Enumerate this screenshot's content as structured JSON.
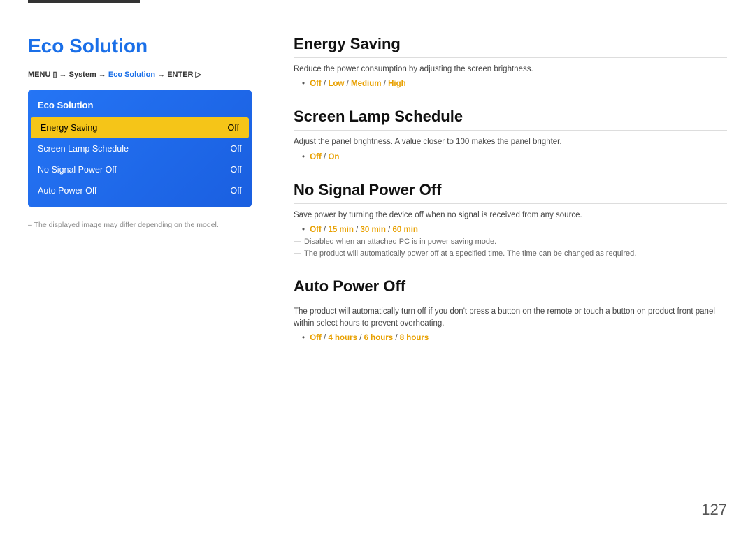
{
  "top": {
    "lines": true
  },
  "left": {
    "title": "Eco Solution",
    "menu_path": "MENU ⧧ → System → Eco Solution → ENTER ⧨",
    "menu_box_title": "Eco Solution",
    "menu_items": [
      {
        "label": "Energy Saving",
        "value": "Off",
        "active": true
      },
      {
        "label": "Screen Lamp Schedule",
        "value": "Off",
        "active": false
      },
      {
        "label": "No Signal Power Off",
        "value": "Off",
        "active": false
      },
      {
        "label": "Auto Power Off",
        "value": "Off",
        "active": false
      }
    ],
    "bottom_note": "– The displayed image may differ depending on the model."
  },
  "right": {
    "sections": [
      {
        "id": "energy-saving",
        "title": "Energy Saving",
        "desc": "Reduce the power consumption by adjusting the screen brightness.",
        "options_prefix": "•",
        "options": "Off / Low / Medium / High",
        "notes": []
      },
      {
        "id": "screen-lamp-schedule",
        "title": "Screen Lamp Schedule",
        "desc": "Adjust the panel brightness. A value closer to 100 makes the panel brighter.",
        "options_prefix": "•",
        "options": "Off / On",
        "notes": []
      },
      {
        "id": "no-signal-power-off",
        "title": "No Signal Power Off",
        "desc": "Save power by turning the device off when no signal is received from any source.",
        "options_prefix": "•",
        "options": "Off / 15 min / 30 min / 60 min",
        "notes": [
          "Disabled when an attached PC is in power saving mode.",
          "The product will automatically power off at a specified time. The time can be changed as required."
        ]
      },
      {
        "id": "auto-power-off",
        "title": "Auto Power Off",
        "desc": "The product will automatically turn off if you don't press a button on the remote or touch a button on product front panel within select hours to prevent overheating.",
        "options_prefix": "•",
        "options": "Off / 4 hours / 6 hours / 8 hours",
        "notes": []
      }
    ]
  },
  "page_number": "127"
}
